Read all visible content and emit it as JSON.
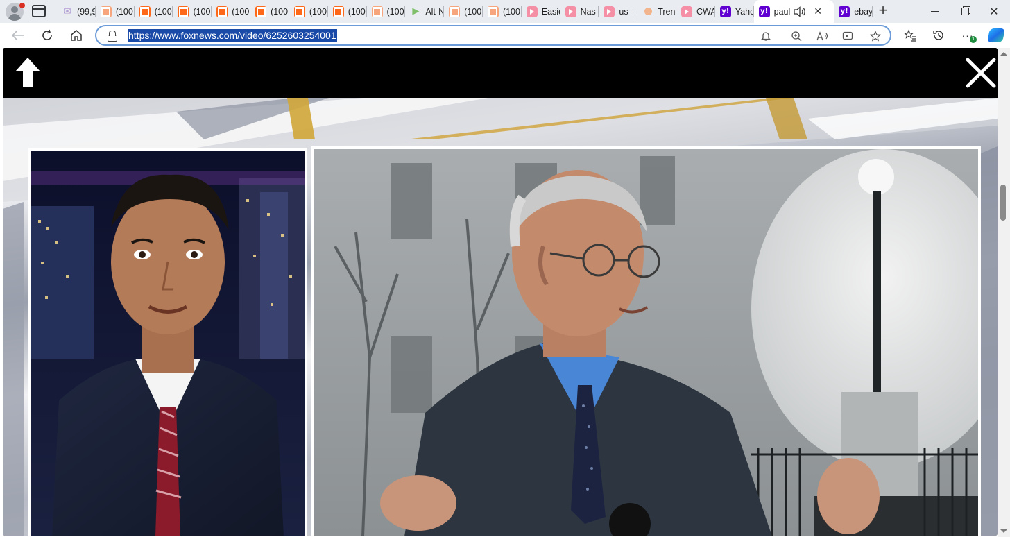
{
  "browser": {
    "tabs": [
      {
        "label": "(99,9",
        "icon": "mail-icon",
        "active": false
      },
      {
        "label": "(100",
        "icon": "substack-icon",
        "active": false
      },
      {
        "label": "(100",
        "icon": "substack-icon",
        "active": false
      },
      {
        "label": "(100",
        "icon": "substack-icon",
        "active": false
      },
      {
        "label": "(100",
        "icon": "substack-icon",
        "active": false
      },
      {
        "label": "(100",
        "icon": "substack-icon",
        "active": false
      },
      {
        "label": "(100",
        "icon": "substack-icon",
        "active": false
      },
      {
        "label": "(100",
        "icon": "substack-icon",
        "active": false
      },
      {
        "label": "(100",
        "icon": "substack-icon",
        "active": false
      },
      {
        "label": "Alt-N",
        "icon": "play-icon",
        "active": false
      },
      {
        "label": "(100",
        "icon": "substack-icon",
        "active": false
      },
      {
        "label": "(100",
        "icon": "substack-icon",
        "active": false
      },
      {
        "label": "Easie",
        "icon": "video-icon",
        "active": false
      },
      {
        "label": "Nas",
        "icon": "video-icon",
        "active": false
      },
      {
        "label": "us -",
        "icon": "video-icon",
        "active": false
      },
      {
        "label": "Tren",
        "icon": "dot-icon",
        "active": false
      },
      {
        "label": "CWA",
        "icon": "video-icon",
        "active": false
      },
      {
        "label": "Yaho",
        "icon": "yahoo-icon",
        "active": false
      },
      {
        "label": "paul",
        "icon": "yahoo-icon",
        "active": true
      },
      {
        "label": "ebay",
        "icon": "yahoo-icon",
        "active": false
      }
    ],
    "url": "https://www.foxnews.com/video/6252603254001",
    "extensions_badge": "1"
  },
  "colors": {
    "tabstrip": "#e9ecf0",
    "omnibox_border": "#6b9bd8",
    "url_highlight": "#1a4aa8",
    "substack": "#ff6719",
    "yahoo": "#6001d2"
  }
}
